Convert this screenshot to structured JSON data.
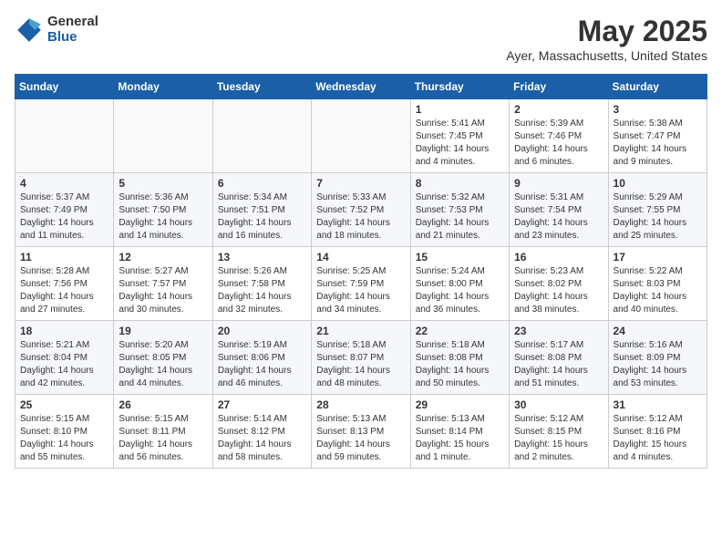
{
  "logo": {
    "general": "General",
    "blue": "Blue"
  },
  "title": "May 2025",
  "location": "Ayer, Massachusetts, United States",
  "days_of_week": [
    "Sunday",
    "Monday",
    "Tuesday",
    "Wednesday",
    "Thursday",
    "Friday",
    "Saturday"
  ],
  "weeks": [
    [
      {
        "day": "",
        "info": ""
      },
      {
        "day": "",
        "info": ""
      },
      {
        "day": "",
        "info": ""
      },
      {
        "day": "",
        "info": ""
      },
      {
        "day": "1",
        "info": "Sunrise: 5:41 AM\nSunset: 7:45 PM\nDaylight: 14 hours\nand 4 minutes."
      },
      {
        "day": "2",
        "info": "Sunrise: 5:39 AM\nSunset: 7:46 PM\nDaylight: 14 hours\nand 6 minutes."
      },
      {
        "day": "3",
        "info": "Sunrise: 5:38 AM\nSunset: 7:47 PM\nDaylight: 14 hours\nand 9 minutes."
      }
    ],
    [
      {
        "day": "4",
        "info": "Sunrise: 5:37 AM\nSunset: 7:49 PM\nDaylight: 14 hours\nand 11 minutes."
      },
      {
        "day": "5",
        "info": "Sunrise: 5:36 AM\nSunset: 7:50 PM\nDaylight: 14 hours\nand 14 minutes."
      },
      {
        "day": "6",
        "info": "Sunrise: 5:34 AM\nSunset: 7:51 PM\nDaylight: 14 hours\nand 16 minutes."
      },
      {
        "day": "7",
        "info": "Sunrise: 5:33 AM\nSunset: 7:52 PM\nDaylight: 14 hours\nand 18 minutes."
      },
      {
        "day": "8",
        "info": "Sunrise: 5:32 AM\nSunset: 7:53 PM\nDaylight: 14 hours\nand 21 minutes."
      },
      {
        "day": "9",
        "info": "Sunrise: 5:31 AM\nSunset: 7:54 PM\nDaylight: 14 hours\nand 23 minutes."
      },
      {
        "day": "10",
        "info": "Sunrise: 5:29 AM\nSunset: 7:55 PM\nDaylight: 14 hours\nand 25 minutes."
      }
    ],
    [
      {
        "day": "11",
        "info": "Sunrise: 5:28 AM\nSunset: 7:56 PM\nDaylight: 14 hours\nand 27 minutes."
      },
      {
        "day": "12",
        "info": "Sunrise: 5:27 AM\nSunset: 7:57 PM\nDaylight: 14 hours\nand 30 minutes."
      },
      {
        "day": "13",
        "info": "Sunrise: 5:26 AM\nSunset: 7:58 PM\nDaylight: 14 hours\nand 32 minutes."
      },
      {
        "day": "14",
        "info": "Sunrise: 5:25 AM\nSunset: 7:59 PM\nDaylight: 14 hours\nand 34 minutes."
      },
      {
        "day": "15",
        "info": "Sunrise: 5:24 AM\nSunset: 8:00 PM\nDaylight: 14 hours\nand 36 minutes."
      },
      {
        "day": "16",
        "info": "Sunrise: 5:23 AM\nSunset: 8:02 PM\nDaylight: 14 hours\nand 38 minutes."
      },
      {
        "day": "17",
        "info": "Sunrise: 5:22 AM\nSunset: 8:03 PM\nDaylight: 14 hours\nand 40 minutes."
      }
    ],
    [
      {
        "day": "18",
        "info": "Sunrise: 5:21 AM\nSunset: 8:04 PM\nDaylight: 14 hours\nand 42 minutes."
      },
      {
        "day": "19",
        "info": "Sunrise: 5:20 AM\nSunset: 8:05 PM\nDaylight: 14 hours\nand 44 minutes."
      },
      {
        "day": "20",
        "info": "Sunrise: 5:19 AM\nSunset: 8:06 PM\nDaylight: 14 hours\nand 46 minutes."
      },
      {
        "day": "21",
        "info": "Sunrise: 5:18 AM\nSunset: 8:07 PM\nDaylight: 14 hours\nand 48 minutes."
      },
      {
        "day": "22",
        "info": "Sunrise: 5:18 AM\nSunset: 8:08 PM\nDaylight: 14 hours\nand 50 minutes."
      },
      {
        "day": "23",
        "info": "Sunrise: 5:17 AM\nSunset: 8:08 PM\nDaylight: 14 hours\nand 51 minutes."
      },
      {
        "day": "24",
        "info": "Sunrise: 5:16 AM\nSunset: 8:09 PM\nDaylight: 14 hours\nand 53 minutes."
      }
    ],
    [
      {
        "day": "25",
        "info": "Sunrise: 5:15 AM\nSunset: 8:10 PM\nDaylight: 14 hours\nand 55 minutes."
      },
      {
        "day": "26",
        "info": "Sunrise: 5:15 AM\nSunset: 8:11 PM\nDaylight: 14 hours\nand 56 minutes."
      },
      {
        "day": "27",
        "info": "Sunrise: 5:14 AM\nSunset: 8:12 PM\nDaylight: 14 hours\nand 58 minutes."
      },
      {
        "day": "28",
        "info": "Sunrise: 5:13 AM\nSunset: 8:13 PM\nDaylight: 14 hours\nand 59 minutes."
      },
      {
        "day": "29",
        "info": "Sunrise: 5:13 AM\nSunset: 8:14 PM\nDaylight: 15 hours\nand 1 minute."
      },
      {
        "day": "30",
        "info": "Sunrise: 5:12 AM\nSunset: 8:15 PM\nDaylight: 15 hours\nand 2 minutes."
      },
      {
        "day": "31",
        "info": "Sunrise: 5:12 AM\nSunset: 8:16 PM\nDaylight: 15 hours\nand 4 minutes."
      }
    ]
  ]
}
